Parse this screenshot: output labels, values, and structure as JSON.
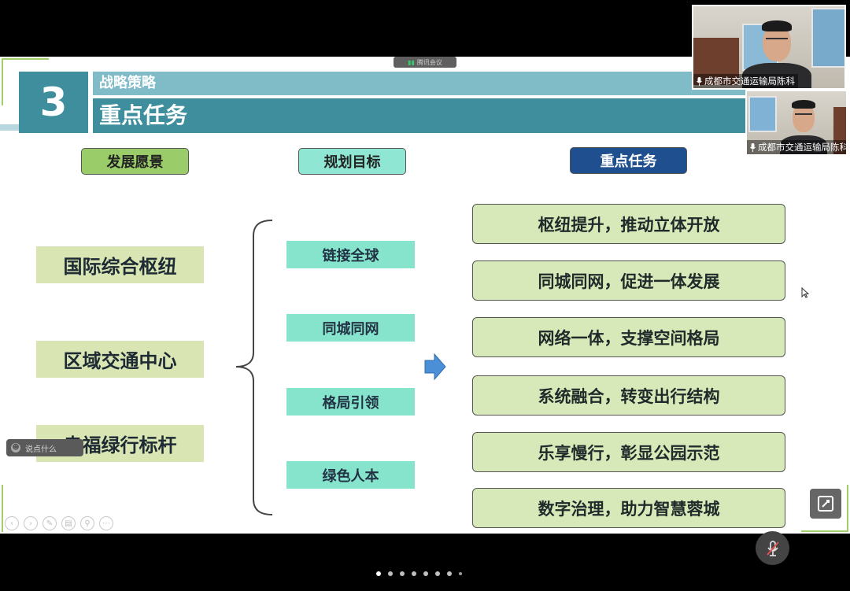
{
  "meeting": {
    "app_label": "腾讯会议"
  },
  "slide": {
    "section_number": "3",
    "section_title": "战略策略",
    "title": "重点任务",
    "columns": {
      "vision": "发展愿景",
      "goals": "规划目标",
      "tasks": "重点任务"
    },
    "visions": [
      "国际综合枢纽",
      "区域交通中心",
      "幸福绿行标杆"
    ],
    "goals": [
      "链接全球",
      "同城同网",
      "格局引领",
      "绿色人本"
    ],
    "tasks": [
      "枢纽提升，推动立体开放",
      "同城同网，促进一体发展",
      "网络一体，支撑空间格局",
      "系统融合，转变出行结构",
      "乐享慢行，彰显公园示范",
      "数字治理，助力智慧蓉城"
    ]
  },
  "chat": {
    "placeholder": "说点什么"
  },
  "participants": [
    {
      "name": "成都市交通运输局陈科"
    },
    {
      "name": "成都市交通运输局陈科"
    }
  ],
  "colors": {
    "header_teal": "#3e8e9e",
    "task_button": "#1f4f8e",
    "task_fill": "#d7e9b8"
  },
  "icons": [
    "signal-icon",
    "smile-icon",
    "mic-icon",
    "mic-off-icon",
    "edit-icon",
    "arrow-right-icon",
    "brace-icon",
    "cursor-icon"
  ]
}
